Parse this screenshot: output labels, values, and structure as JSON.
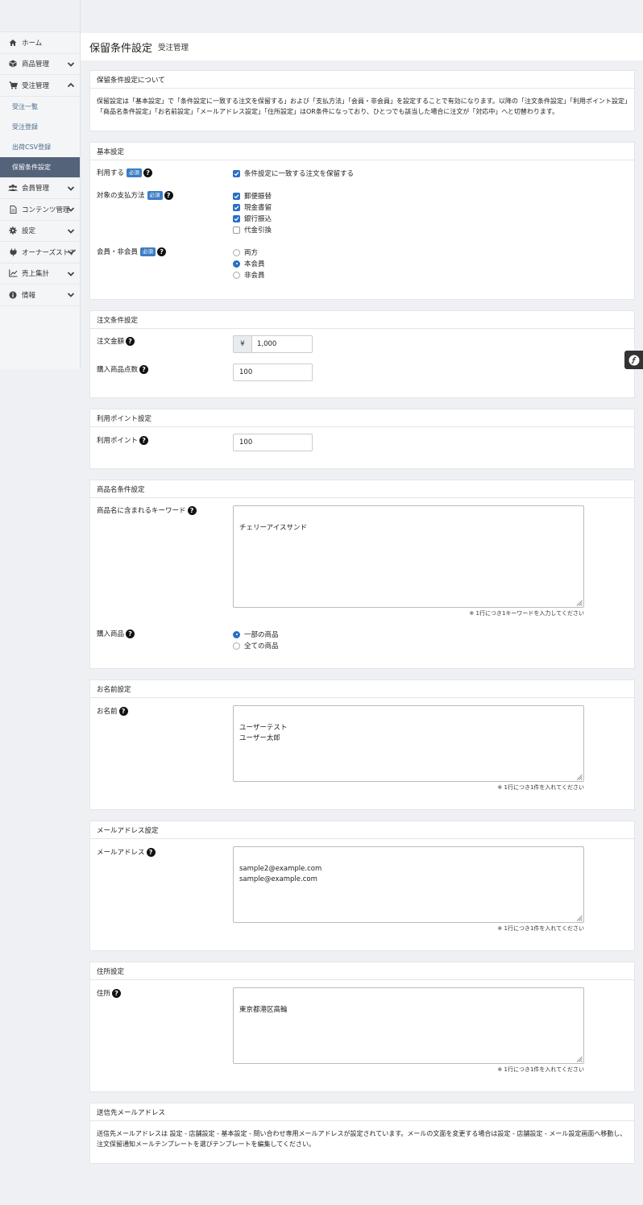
{
  "header": {
    "title": "保留条件設定",
    "subtitle": "受注管理"
  },
  "sidebar": {
    "items": [
      {
        "label": "ホーム",
        "icon": "home-icon"
      },
      {
        "label": "商品管理",
        "icon": "cube-icon"
      },
      {
        "label": "受注管理",
        "icon": "cart-icon"
      },
      {
        "label": "会員管理",
        "icon": "users-icon"
      },
      {
        "label": "コンテンツ管理",
        "icon": "file-icon"
      },
      {
        "label": "設定",
        "icon": "gear-icon"
      },
      {
        "label": "オーナーズストア",
        "icon": "plug-icon"
      },
      {
        "label": "売上集計",
        "icon": "chart-icon"
      },
      {
        "label": "情報",
        "icon": "info-icon"
      }
    ],
    "order_sub": [
      "受注一覧",
      "受注登録",
      "出荷CSV登録",
      "保留条件設定"
    ]
  },
  "about": {
    "title": "保留条件設定について",
    "text": "保留設定は「基本設定」で「条件設定に一致する注文を保留する」および「支払方法」「会員・非会員」を設定することで有効になります。以降の「注文条件設定」「利用ポイント設定」「商品名条件設定」「お名前設定」「メールアドレス設定」「住所設定」はOR条件になっており、ひとつでも該当した場合に注文が「対応中」へと切替わります。"
  },
  "basic": {
    "title": "基本設定",
    "required": "必須",
    "use_label": "利用する",
    "use_option": "条件設定に一致する注文を保留する",
    "payment_label": "対象の支払方法",
    "payments": [
      "郵便振替",
      "現金書留",
      "銀行振込",
      "代金引換"
    ],
    "member_label": "会員・非会員",
    "members": [
      "両方",
      "本会員",
      "非会員"
    ]
  },
  "order": {
    "title": "注文条件設定",
    "amount_label": "注文金額",
    "currency": "¥",
    "amount_value": "1,000",
    "qty_label": "購入商品点数",
    "qty_value": "100"
  },
  "point": {
    "title": "利用ポイント設定",
    "label": "利用ポイント",
    "value": "100"
  },
  "product": {
    "title": "商品名条件設定",
    "keyword_label": "商品名に含まれるキーワード",
    "keyword_value": "チェリーアイスサンド",
    "keyword_hint": "※ 1行につき1キーワードを入力してください",
    "scope_label": "購入商品",
    "scopes": [
      "一部の商品",
      "全ての商品"
    ]
  },
  "name": {
    "title": "お名前設定",
    "label": "お名前",
    "value": "ユーザーテスト\nユーザー太郎",
    "hint": "※ 1行につき1件を入れてください"
  },
  "email": {
    "title": "メールアドレス設定",
    "label": "メールアドレス",
    "value": "sample2@example.com\nsample@example.com",
    "hint": "※ 1行につき1件を入れてください"
  },
  "address": {
    "title": "住所設定",
    "label": "住所",
    "value": "東京都港区高輪",
    "hint": "※ 1行につき1件を入れてください"
  },
  "notify": {
    "title": "送信先メールアドレス",
    "text": "送信先メールアドレスは 設定 - 店舗設定 - 基本設定 - 問い合わせ専用メールアドレスが設定されています。メールの文面を変更する場合は設定 - 店舗設定 - メール設定画面へ移動し、注文保留通知メールテンプレートを選びテンプレートを編集してください。"
  },
  "colors": {
    "accent": "#2a6fc2",
    "sidebar_active": "#54637a",
    "badge": "#3b7dc4"
  }
}
